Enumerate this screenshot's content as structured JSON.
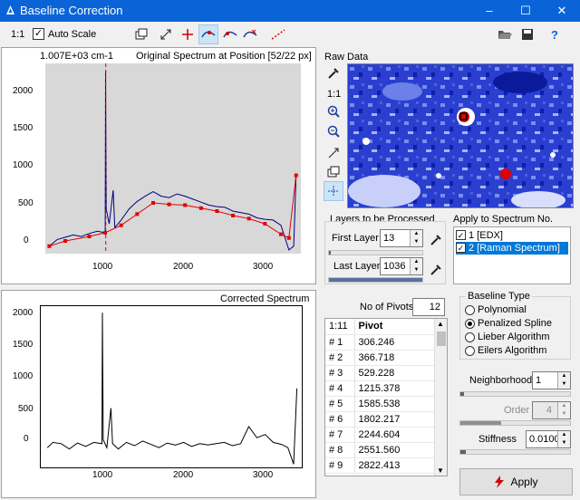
{
  "window": {
    "title": "Baseline Correction",
    "minimize": "–",
    "maximize": "☐",
    "close": "✕"
  },
  "toolbar": {
    "zoom_ratio": "1:1",
    "auto_scale_label": "Auto Scale",
    "auto_scale_checked": true,
    "help": "?"
  },
  "top_plot": {
    "cursor_readout": "1.007E+03 cm-1",
    "title": "Original Spectrum at Position [52/22 px]",
    "y_ticks": [
      "2000",
      "1500",
      "1000",
      "500",
      "0"
    ],
    "x_ticks": [
      "1000",
      "2000",
      "3000"
    ],
    "xlim": [
      250,
      3450
    ],
    "ylim": [
      -150,
      2400
    ],
    "spectrum": [
      [
        300,
        -50
      ],
      [
        400,
        40
      ],
      [
        500,
        70
      ],
      [
        600,
        100
      ],
      [
        700,
        80
      ],
      [
        800,
        120
      ],
      [
        900,
        150
      ],
      [
        1000,
        130
      ],
      [
        1005,
        2300
      ],
      [
        1012,
        450
      ],
      [
        1050,
        250
      ],
      [
        1100,
        700
      ],
      [
        1120,
        200
      ],
      [
        1200,
        300
      ],
      [
        1300,
        450
      ],
      [
        1400,
        550
      ],
      [
        1500,
        620
      ],
      [
        1600,
        680
      ],
      [
        1700,
        620
      ],
      [
        1800,
        600
      ],
      [
        1900,
        650
      ],
      [
        2000,
        620
      ],
      [
        2100,
        580
      ],
      [
        2200,
        540
      ],
      [
        2300,
        500
      ],
      [
        2400,
        480
      ],
      [
        2500,
        470
      ],
      [
        2600,
        420
      ],
      [
        2700,
        400
      ],
      [
        2800,
        380
      ],
      [
        2900,
        330
      ],
      [
        3000,
        310
      ],
      [
        3100,
        300
      ],
      [
        3200,
        230
      ],
      [
        3300,
        -100
      ],
      [
        3360,
        -50
      ],
      [
        3390,
        900
      ]
    ],
    "baseline": [
      [
        300,
        -50
      ],
      [
        500,
        20
      ],
      [
        800,
        80
      ],
      [
        1000,
        130
      ],
      [
        1200,
        230
      ],
      [
        1400,
        380
      ],
      [
        1600,
        530
      ],
      [
        1800,
        510
      ],
      [
        2000,
        500
      ],
      [
        2200,
        460
      ],
      [
        2400,
        420
      ],
      [
        2600,
        360
      ],
      [
        2800,
        320
      ],
      [
        3000,
        250
      ],
      [
        3200,
        110
      ],
      [
        3300,
        60
      ],
      [
        3390,
        900
      ]
    ]
  },
  "bottom_plot": {
    "title": "Corrected Spectrum",
    "y_ticks": [
      "2000",
      "1500",
      "1000",
      "500",
      "0"
    ],
    "x_ticks": [
      "1000",
      "2000",
      "3000"
    ],
    "xlim": [
      250,
      3450
    ],
    "ylim": [
      -300,
      2150
    ],
    "spectrum": [
      [
        330,
        0
      ],
      [
        400,
        80
      ],
      [
        500,
        60
      ],
      [
        600,
        -20
      ],
      [
        700,
        70
      ],
      [
        800,
        20
      ],
      [
        900,
        80
      ],
      [
        1000,
        60
      ],
      [
        1005,
        2050
      ],
      [
        1015,
        120
      ],
      [
        1060,
        0
      ],
      [
        1110,
        600
      ],
      [
        1130,
        60
      ],
      [
        1200,
        -20
      ],
      [
        1300,
        80
      ],
      [
        1400,
        30
      ],
      [
        1500,
        100
      ],
      [
        1600,
        50
      ],
      [
        1700,
        0
      ],
      [
        1800,
        70
      ],
      [
        1900,
        40
      ],
      [
        2000,
        80
      ],
      [
        2100,
        20
      ],
      [
        2200,
        60
      ],
      [
        2300,
        40
      ],
      [
        2400,
        60
      ],
      [
        2500,
        80
      ],
      [
        2600,
        30
      ],
      [
        2700,
        60
      ],
      [
        2800,
        320
      ],
      [
        2900,
        150
      ],
      [
        3000,
        200
      ],
      [
        3100,
        80
      ],
      [
        3200,
        50
      ],
      [
        3280,
        0
      ],
      [
        3350,
        -250
      ],
      [
        3390,
        900
      ]
    ]
  },
  "raw_data": {
    "title": "Raw Data",
    "ratio": "1:1"
  },
  "layers": {
    "title": "Layers to be Processed",
    "first_label": "First Layer",
    "first_value": "13",
    "last_label": "Last Layer",
    "last_value": "1036"
  },
  "apply_to": {
    "title": "Apply to Spectrum No.",
    "items": [
      {
        "label": "1 [EDX]",
        "checked": true,
        "selected": false
      },
      {
        "label": "2 [Raman Spectrum]",
        "checked": true,
        "selected": true
      }
    ]
  },
  "pivots": {
    "count_label": "No of Pivots",
    "count": "12",
    "header": [
      "1:11",
      "Pivot"
    ],
    "rows": [
      [
        "# 1",
        "306.246"
      ],
      [
        "# 2",
        "366.718"
      ],
      [
        "# 3",
        "529.228"
      ],
      [
        "# 4",
        "1215.378"
      ],
      [
        "# 5",
        "1585.538"
      ],
      [
        "# 6",
        "1802.217"
      ],
      [
        "# 7",
        "2244.604"
      ],
      [
        "# 8",
        "2551.560"
      ],
      [
        "# 9",
        "2822.413"
      ]
    ]
  },
  "baseline_type": {
    "title": "Baseline Type",
    "options": [
      "Polynomial",
      "Penalized Spline",
      "Lieber Algorithm",
      "Eilers Algorithm"
    ],
    "selected": "Penalized Spline"
  },
  "params": {
    "neighborhood_label": "Neighborhood",
    "neighborhood_value": "1",
    "order_label": "Order",
    "order_value": "4",
    "stiffness_label": "Stiffness",
    "stiffness_value": "0.0100"
  },
  "apply_button": "Apply",
  "colors": {
    "titlebar": "#0a64d8",
    "spectrum": "#000080",
    "baseline": "#e00000",
    "selection": "#0078d7"
  }
}
